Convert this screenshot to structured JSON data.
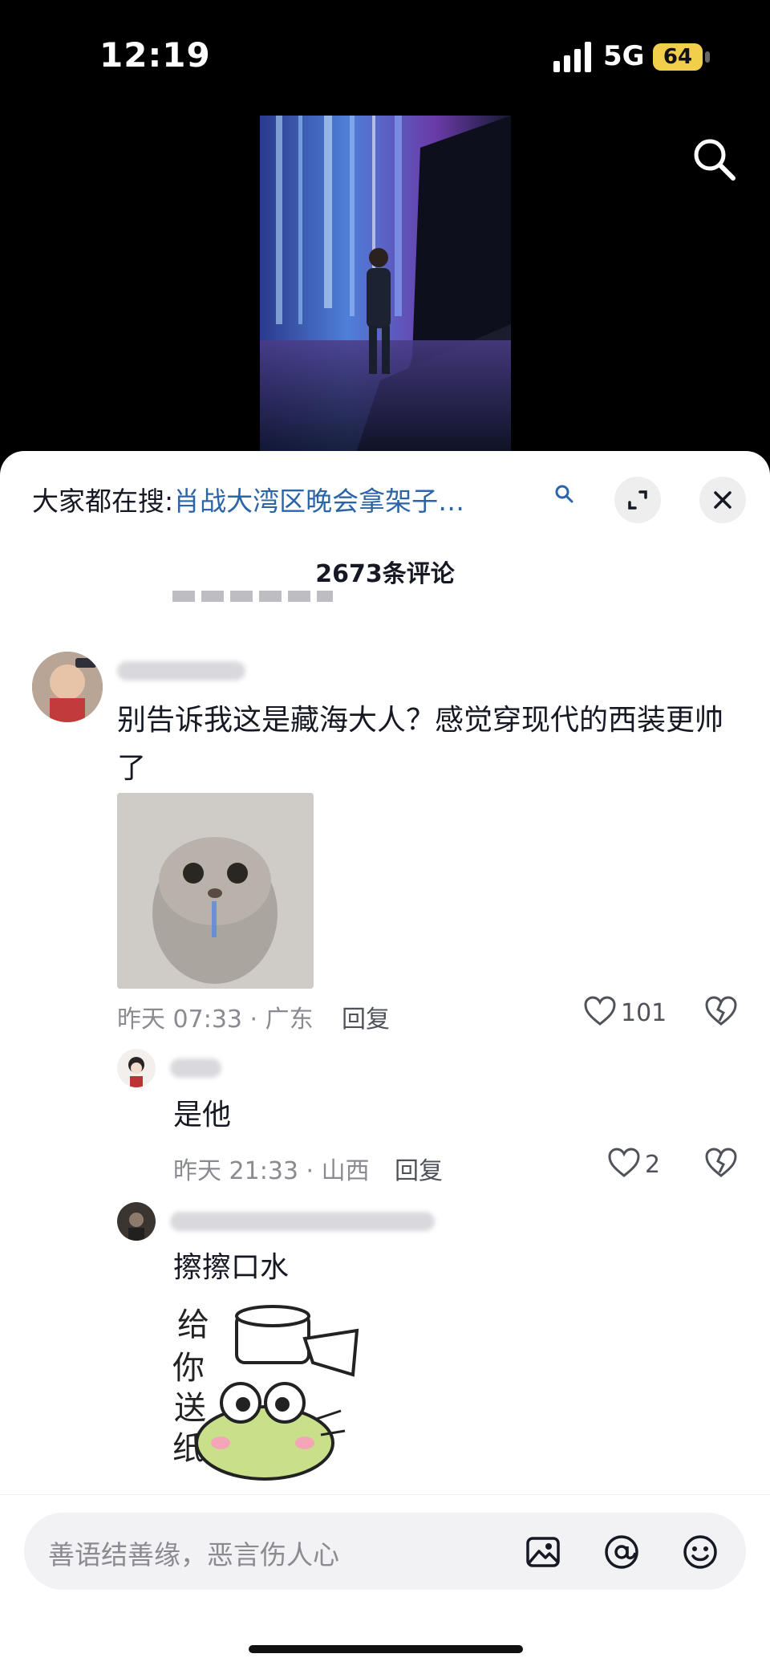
{
  "status_bar": {
    "time": "12:19",
    "network": "5G",
    "battery": "64"
  },
  "comment_sheet": {
    "hot_search_label": "大家都在搜:",
    "hot_search_query": "肖战大湾区晚会拿架子…",
    "comment_count": "2673条评论"
  },
  "comments": [
    {
      "text": "别告诉我这是藏海大人？感觉穿现代的西装更帅了",
      "time_location": "昨天 07:33 · 广东",
      "reply_label": "回复",
      "likes": "101"
    }
  ],
  "replies": [
    {
      "text": "是他",
      "time_location": "昨天 21:33 · 山西",
      "reply_label": "回复",
      "likes": "2"
    },
    {
      "text": "擦擦口水",
      "sticker_text": "给你送纸"
    }
  ],
  "input": {
    "placeholder": "善语结善缘，恶言伤人心"
  },
  "icons": [
    "search-icon",
    "expand-icon",
    "close-icon",
    "heart-icon",
    "broken-heart-icon",
    "image-icon",
    "at-icon",
    "emoji-icon"
  ],
  "colors": {
    "link": "#2c64a8",
    "battery": "#f2cf4a",
    "muted": "#8a8b91"
  }
}
